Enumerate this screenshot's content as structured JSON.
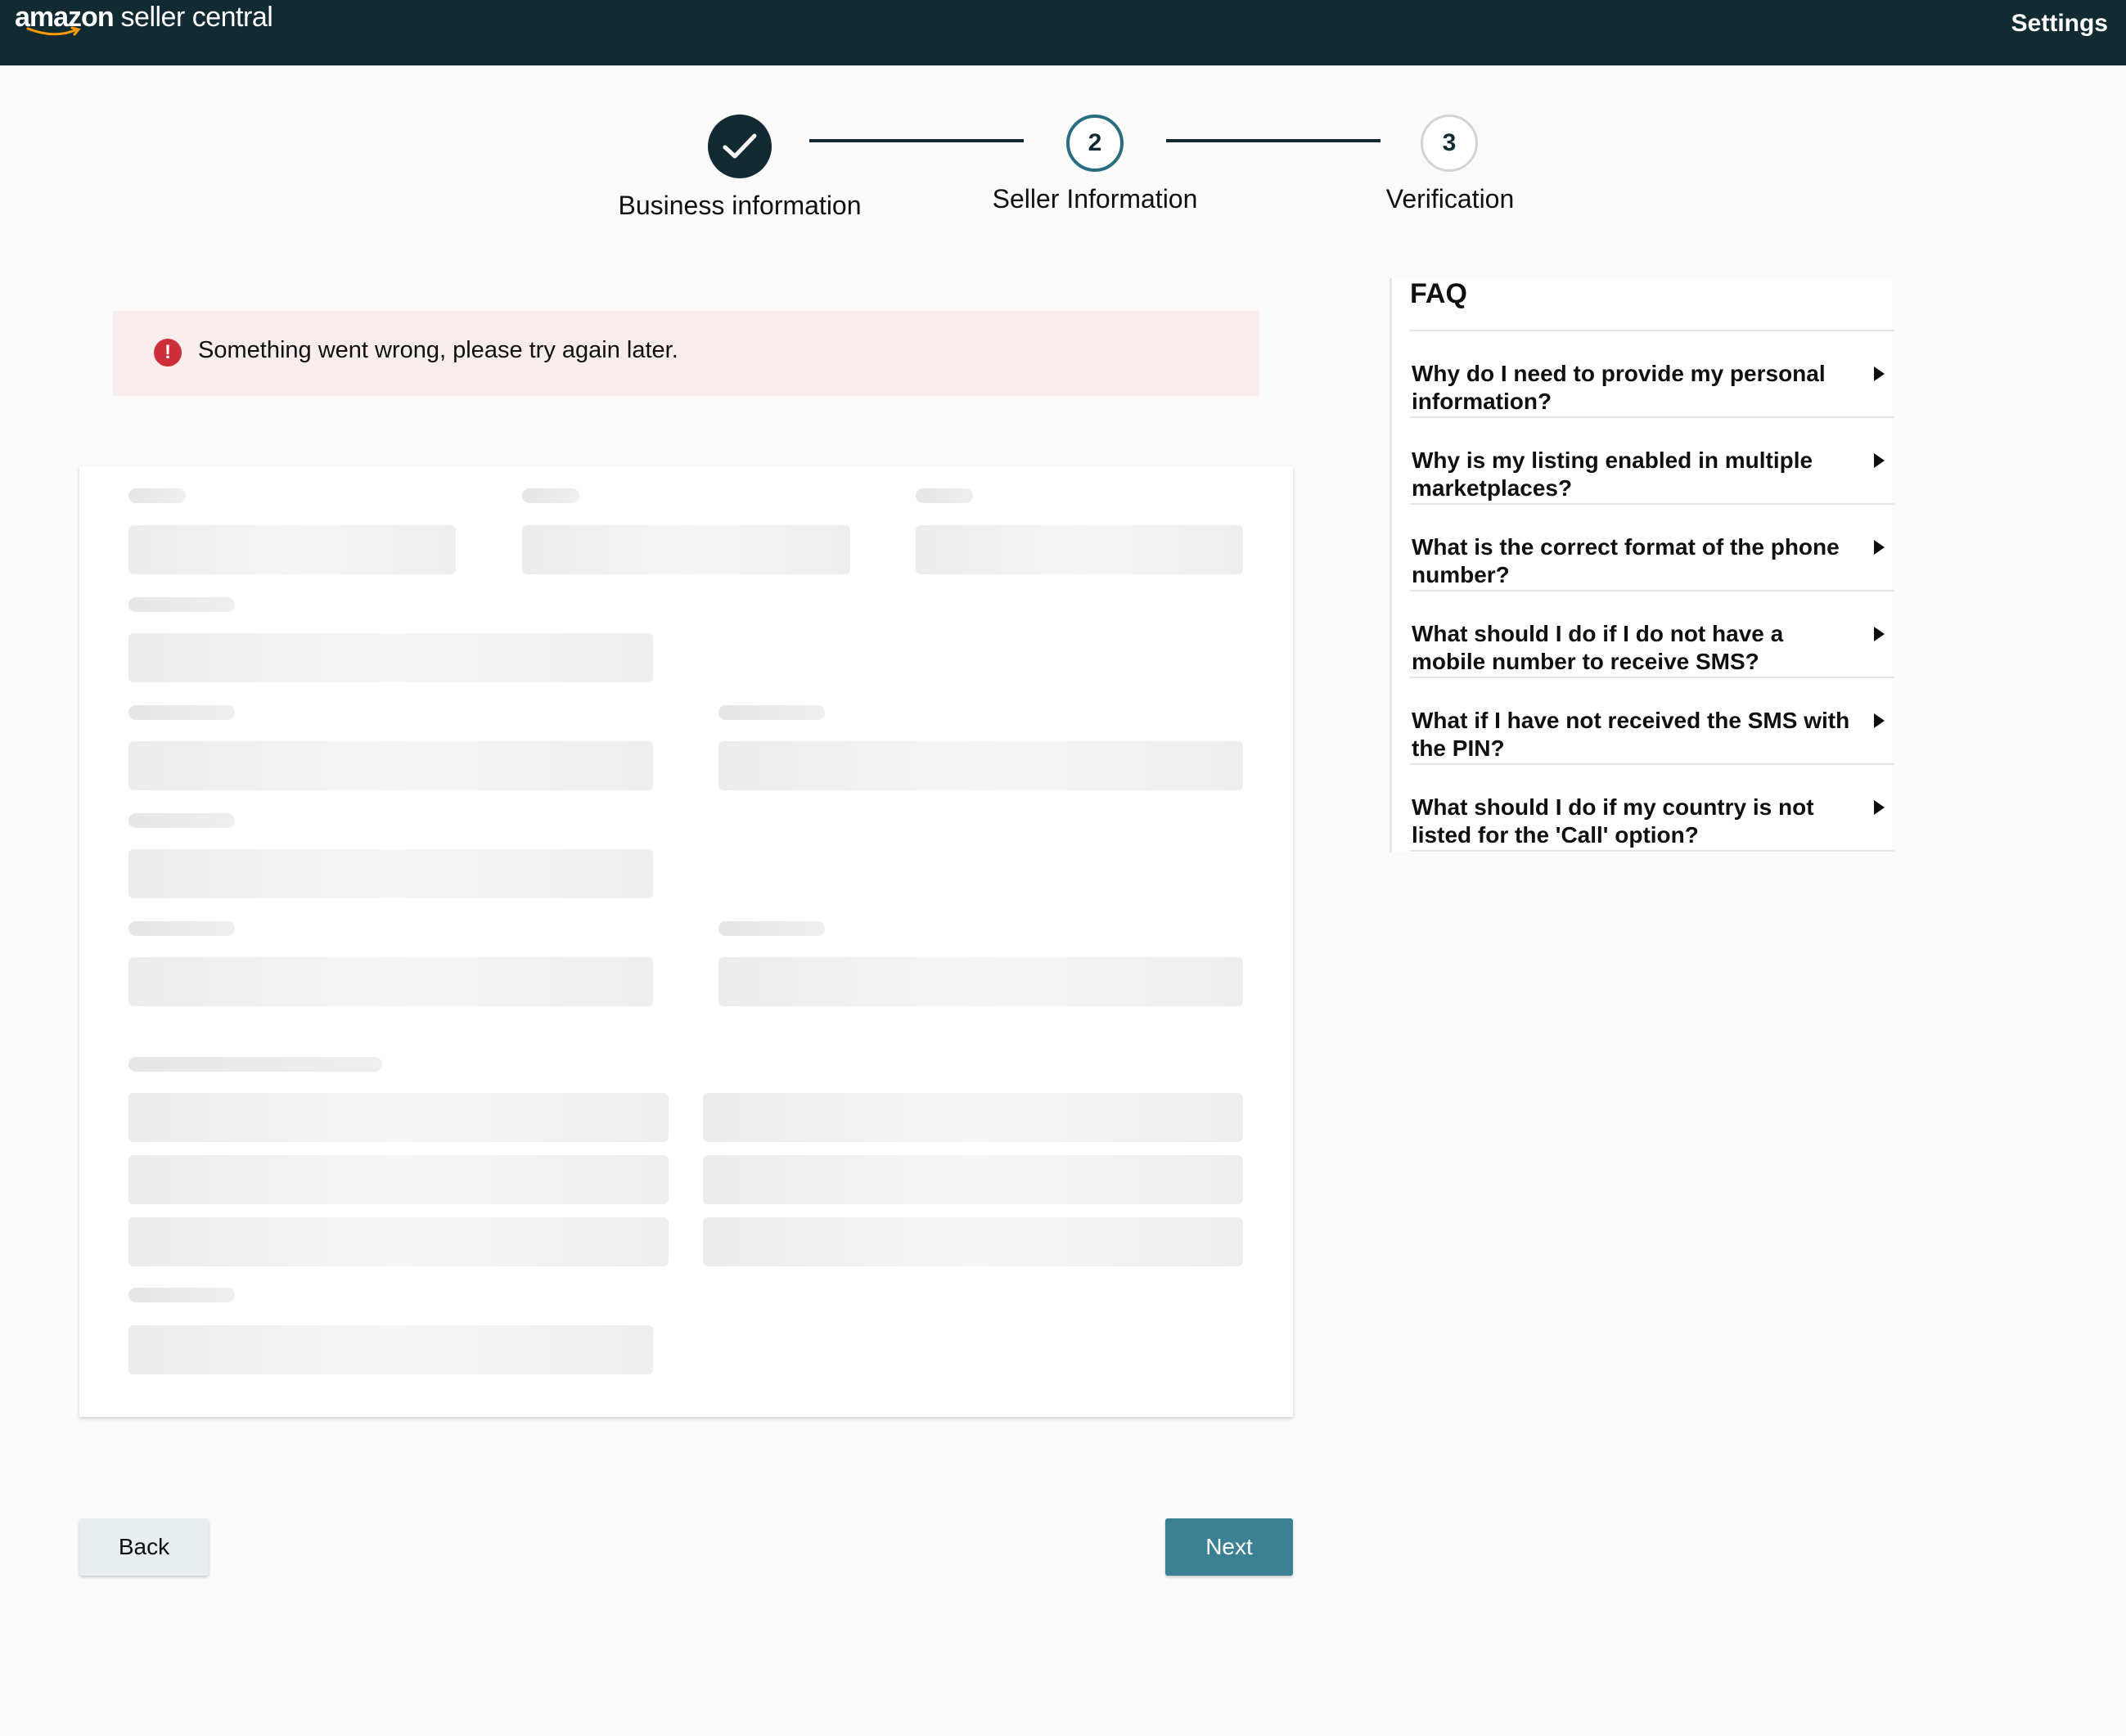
{
  "header": {
    "logo_brand": "amazon",
    "logo_rest": " seller central",
    "settings_label": "Settings"
  },
  "stepper": {
    "steps": [
      {
        "label": "Business information",
        "state": "complete",
        "marker": ""
      },
      {
        "label": "Seller Information",
        "state": "current",
        "marker": "2"
      },
      {
        "label": "Verification",
        "state": "upcoming",
        "marker": "3"
      }
    ]
  },
  "error": {
    "icon": "exclamation-icon",
    "glyph": "!",
    "message": "Something went wrong, please try again later."
  },
  "faq": {
    "title": "FAQ",
    "items": [
      {
        "question": "Why do I need to provide my personal information?"
      },
      {
        "question": "Why is my listing enabled in multiple marketplaces?"
      },
      {
        "question": "What is the correct format of the phone number?"
      },
      {
        "question": "What should I do if I do not have a mobile number to receive SMS?"
      },
      {
        "question": "What if I have not received the SMS with the PIN?"
      },
      {
        "question": "What should I do if my country is not listed for the 'Call' option?"
      }
    ]
  },
  "buttons": {
    "back_label": "Back",
    "next_label": "Next"
  },
  "colors": {
    "header_bg": "#122b33",
    "primary_button": "#3b8193",
    "error_bg": "#f8ecec",
    "error_icon": "#cc2e3a"
  }
}
